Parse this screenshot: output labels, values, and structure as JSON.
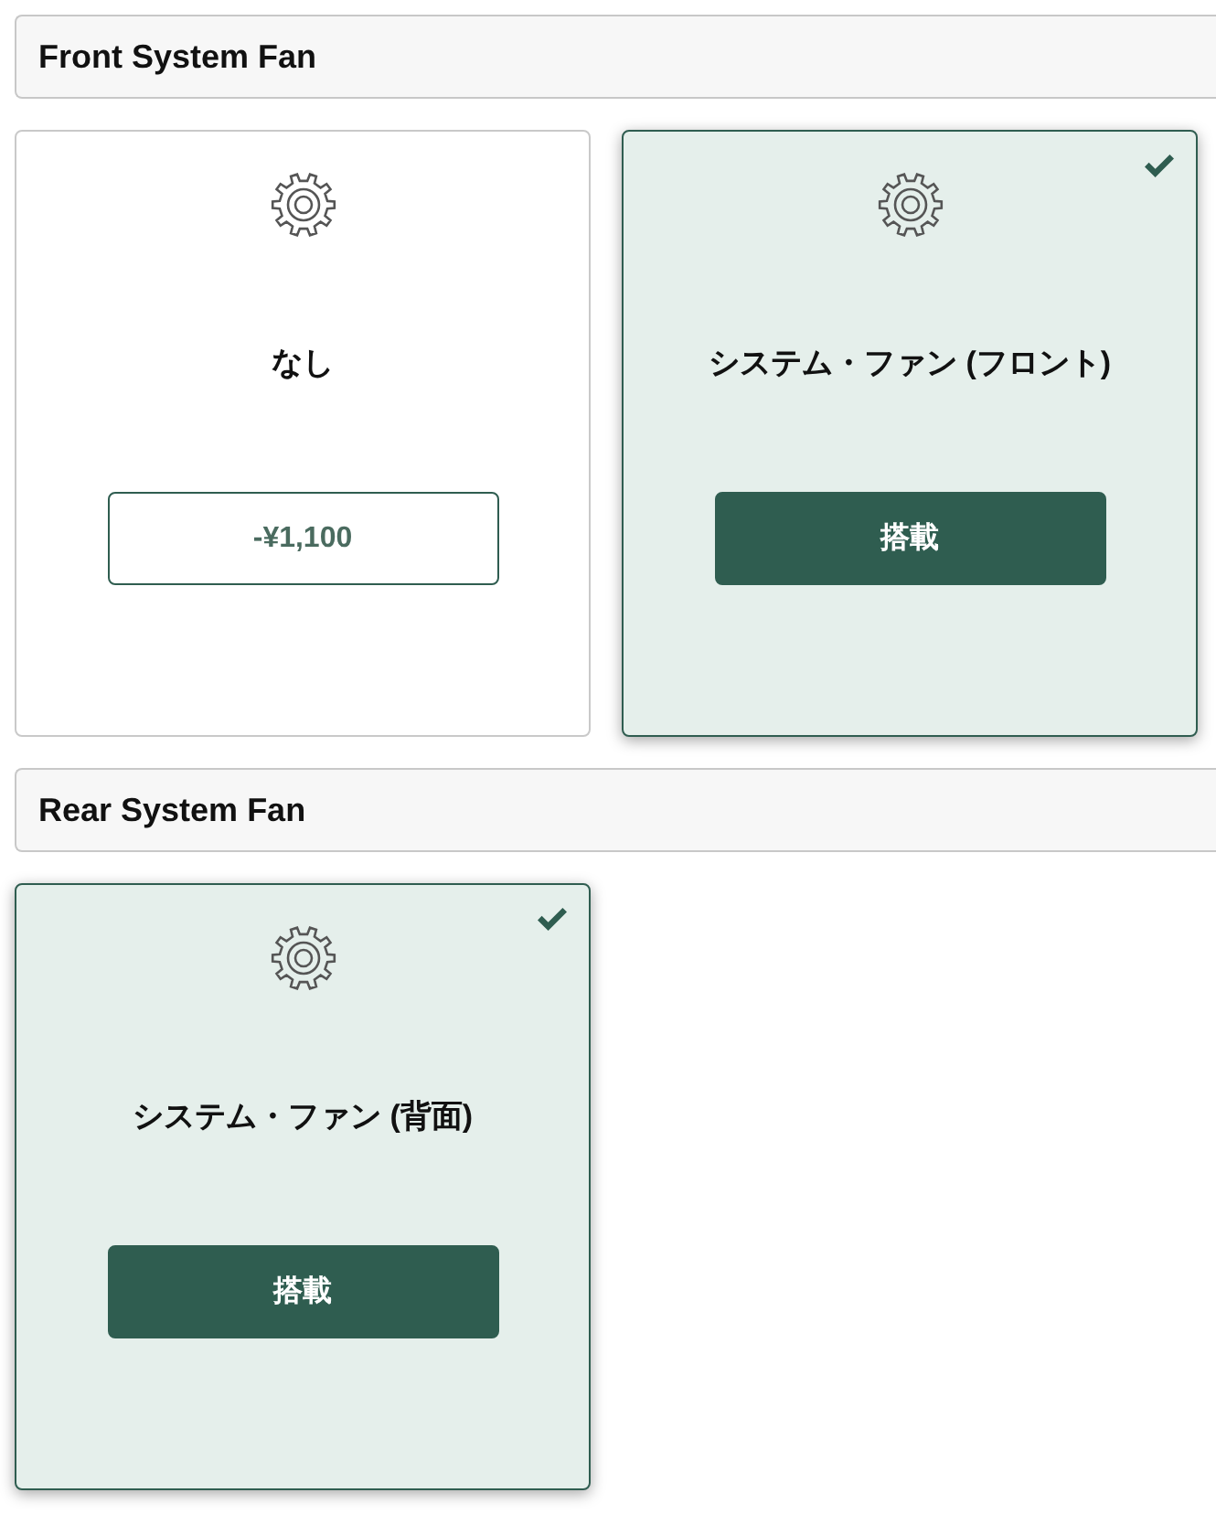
{
  "sections": [
    {
      "title": "Front System Fan",
      "options": [
        {
          "name": "なし",
          "button_label": "-¥1,100",
          "selected": false
        },
        {
          "name": "システム・ファン (フロント)",
          "button_label": "搭載",
          "selected": true
        }
      ]
    },
    {
      "title": "Rear System Fan",
      "options": [
        {
          "name": "システム・ファン (背面)",
          "button_label": "搭載",
          "selected": true
        }
      ]
    }
  ]
}
